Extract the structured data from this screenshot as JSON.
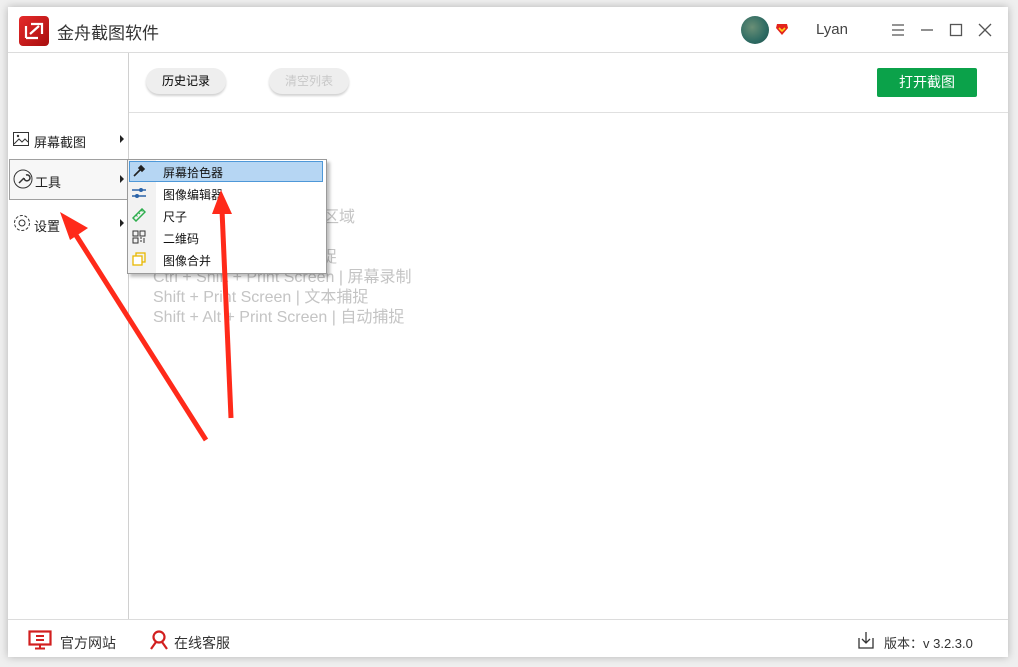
{
  "app": {
    "title": "金舟截图软件",
    "username": "Lyan"
  },
  "titlebar_icons": [
    "menu-icon",
    "minimize-icon",
    "maximize-icon",
    "close-icon"
  ],
  "sidebar": {
    "items": [
      {
        "label": "屏幕截图",
        "icon": "image-icon"
      },
      {
        "label": "工具",
        "icon": "wrench-icon",
        "active": true
      },
      {
        "label": "设置",
        "icon": "gear-icon"
      }
    ]
  },
  "toolbar": {
    "history_label": "历史记录",
    "clear_label": "清空列表",
    "open_label": "打开截图"
  },
  "hints": [
    "形区域",
    "捕捉",
    "Ctrl + Shift + Print Screen  |  屏幕录制",
    "Shift + Print Screen  |  文本捕捉",
    "Shift + Alt + Print Screen  |  自动捕捉"
  ],
  "tools_menu": {
    "items": [
      {
        "label": "屏幕拾色器",
        "icon": "eyedropper-icon",
        "highlighted": true
      },
      {
        "label": "图像编辑器",
        "icon": "sliders-icon"
      },
      {
        "label": "尺子",
        "icon": "ruler-icon"
      },
      {
        "label": "二维码",
        "icon": "qrcode-icon"
      },
      {
        "label": "图像合并",
        "icon": "merge-icon"
      }
    ]
  },
  "footer": {
    "website_label": "官方网站",
    "support_label": "在线客服",
    "version_label": "版本：v 3.2.3.0"
  },
  "colors": {
    "accent_green": "#0ba24a",
    "brand_red": "#d21f1f",
    "menu_highlight": "#b6d6f3",
    "annotation_red": "#ff2a1a"
  }
}
